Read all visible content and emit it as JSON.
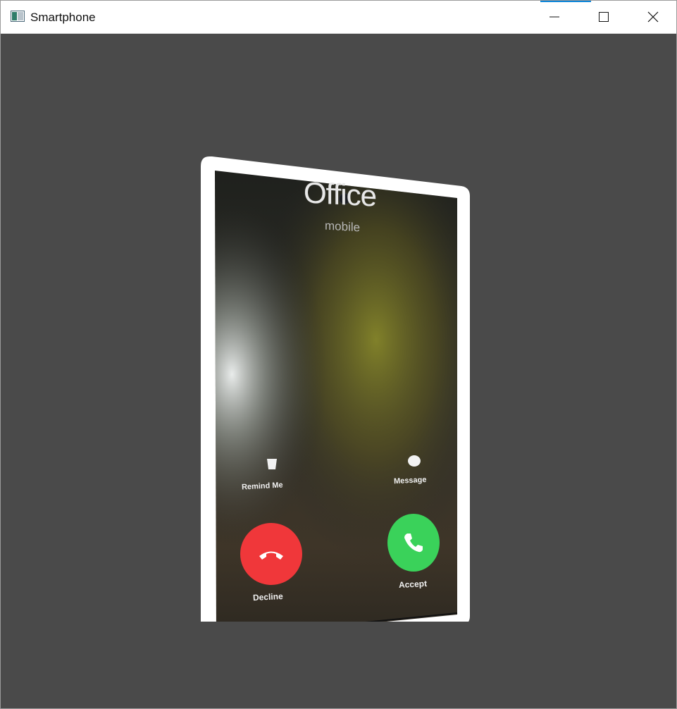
{
  "window": {
    "title": "Smartphone"
  },
  "incoming_call": {
    "caller_name": "Office",
    "caller_type": "mobile",
    "remind_me_label": "Remind Me",
    "message_label": "Message",
    "decline_label": "Decline",
    "accept_label": "Accept"
  },
  "icons": {
    "app": "window-app-icon",
    "minimize": "minimize-icon",
    "maximize": "maximize-icon",
    "close": "close-icon",
    "remind": "alarm-icon",
    "message": "message-icon",
    "decline": "phone-hangup-icon",
    "accept": "phone-answer-icon"
  },
  "colors": {
    "background": "#4a4a4a",
    "phone_frame": "#ffffff",
    "decline": "#f0373a",
    "accept": "#3ad25a",
    "titlebar_accent": "#0a84d8"
  }
}
